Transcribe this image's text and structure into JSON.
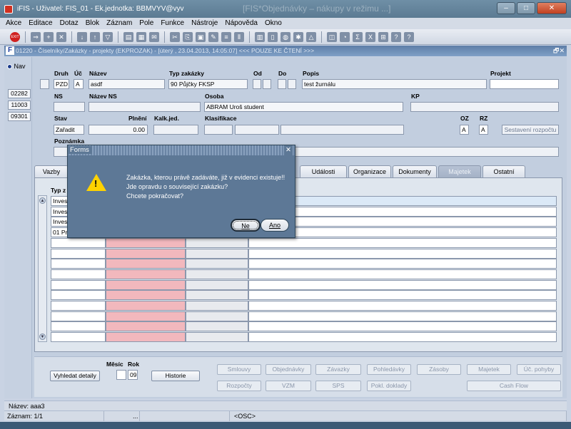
{
  "window": {
    "title": "iFIS - Uživatel: FIS_01 - Ek.jednotka: BBMVYV@vyv",
    "ghost_title": "[FIS*Objednávky – nákupy v režimu ...]",
    "btn_min": "–",
    "btn_max": "□",
    "btn_close": "✕"
  },
  "menu": [
    "Akce",
    "Editace",
    "Dotaz",
    "Blok",
    "Záznam",
    "Pole",
    "Funkce",
    "Nástroje",
    "Nápověda",
    "Okno"
  ],
  "toolbar": {
    "exit_label": "EXIT"
  },
  "form": {
    "title": "01220 - Číselníky/Zakázky - projekty (EKPROZAK) - [úterý , 23.04.2013, 14:05:07] <<< POUZE KE ČTENÍ >>>",
    "title_btn": "🗗✕",
    "form_icon": "F",
    "nav_label": "Nav",
    "left_buttons": [
      "02282",
      "11003",
      "09301"
    ],
    "labels": {
      "druh": "Druh",
      "uc": "Úč",
      "nazev": "Název",
      "typ_zakazky": "Typ zakázky",
      "od": "Od",
      "do": "Do",
      "popis": "Popis",
      "projekt": "Projekt",
      "ns": "NS",
      "nazev_ns": "Název NS",
      "osoba": "Osoba",
      "kp": "KP",
      "stav": "Stav",
      "plneni": "Plnění",
      "kalk_jed": "Kalk.jed.",
      "klasifikace": "Klasifikace",
      "oz": "OZ",
      "rz": "RZ",
      "poznamka": "Poznámka"
    },
    "values": {
      "druh": "PZD",
      "uc": "A",
      "nazev": "asdf",
      "typ_zakazky": "90 Půjčky FKSP",
      "popis": "test žurnálu",
      "osoba": "ABRAM Uroš  student",
      "stav": "Zařadit",
      "plneni": "0.00",
      "oz": "A",
      "rz": "A"
    },
    "sestaveni_btn": "Sestavení rozpočtu"
  },
  "tabs": [
    "Vazby",
    "Události",
    "Organizace",
    "Dokumenty",
    "Majetek",
    "Ostatní"
  ],
  "grid": {
    "header_label": "Typ z",
    "rows": [
      "Inves",
      "Inves",
      "Inves",
      "01 Pr"
    ]
  },
  "bottom": {
    "vyhledat": "Vyhledat detaily",
    "mesic_label": "Měsíc",
    "rok_label": "Rok",
    "rok_value": "09",
    "historie": "Historie",
    "buttons_row1": [
      "Smlouvy",
      "Objednávky",
      "Závazky",
      "Pohledávky",
      "Zásoby",
      "Majetek",
      "Úč. pohyby"
    ],
    "buttons_row2": [
      "Rozpočty",
      "VZM",
      "SPS",
      "Pokl. doklady",
      "Cash Flow"
    ]
  },
  "status": {
    "line1": "Název: aaa3",
    "zaznam": "Záznam: 1/1",
    "dots": "...",
    "osc": "<OSC>"
  },
  "dialog": {
    "title": "Forms",
    "close": "✕",
    "warn_glyph": "!",
    "messages": [
      "Zakázka, kterou právě zadáváte, již v evidenci existuje!!",
      "Jde opravdu o související zakázku?",
      "Chcete pokračovat?"
    ],
    "btn_no": "Ne",
    "btn_yes": "Ano"
  }
}
